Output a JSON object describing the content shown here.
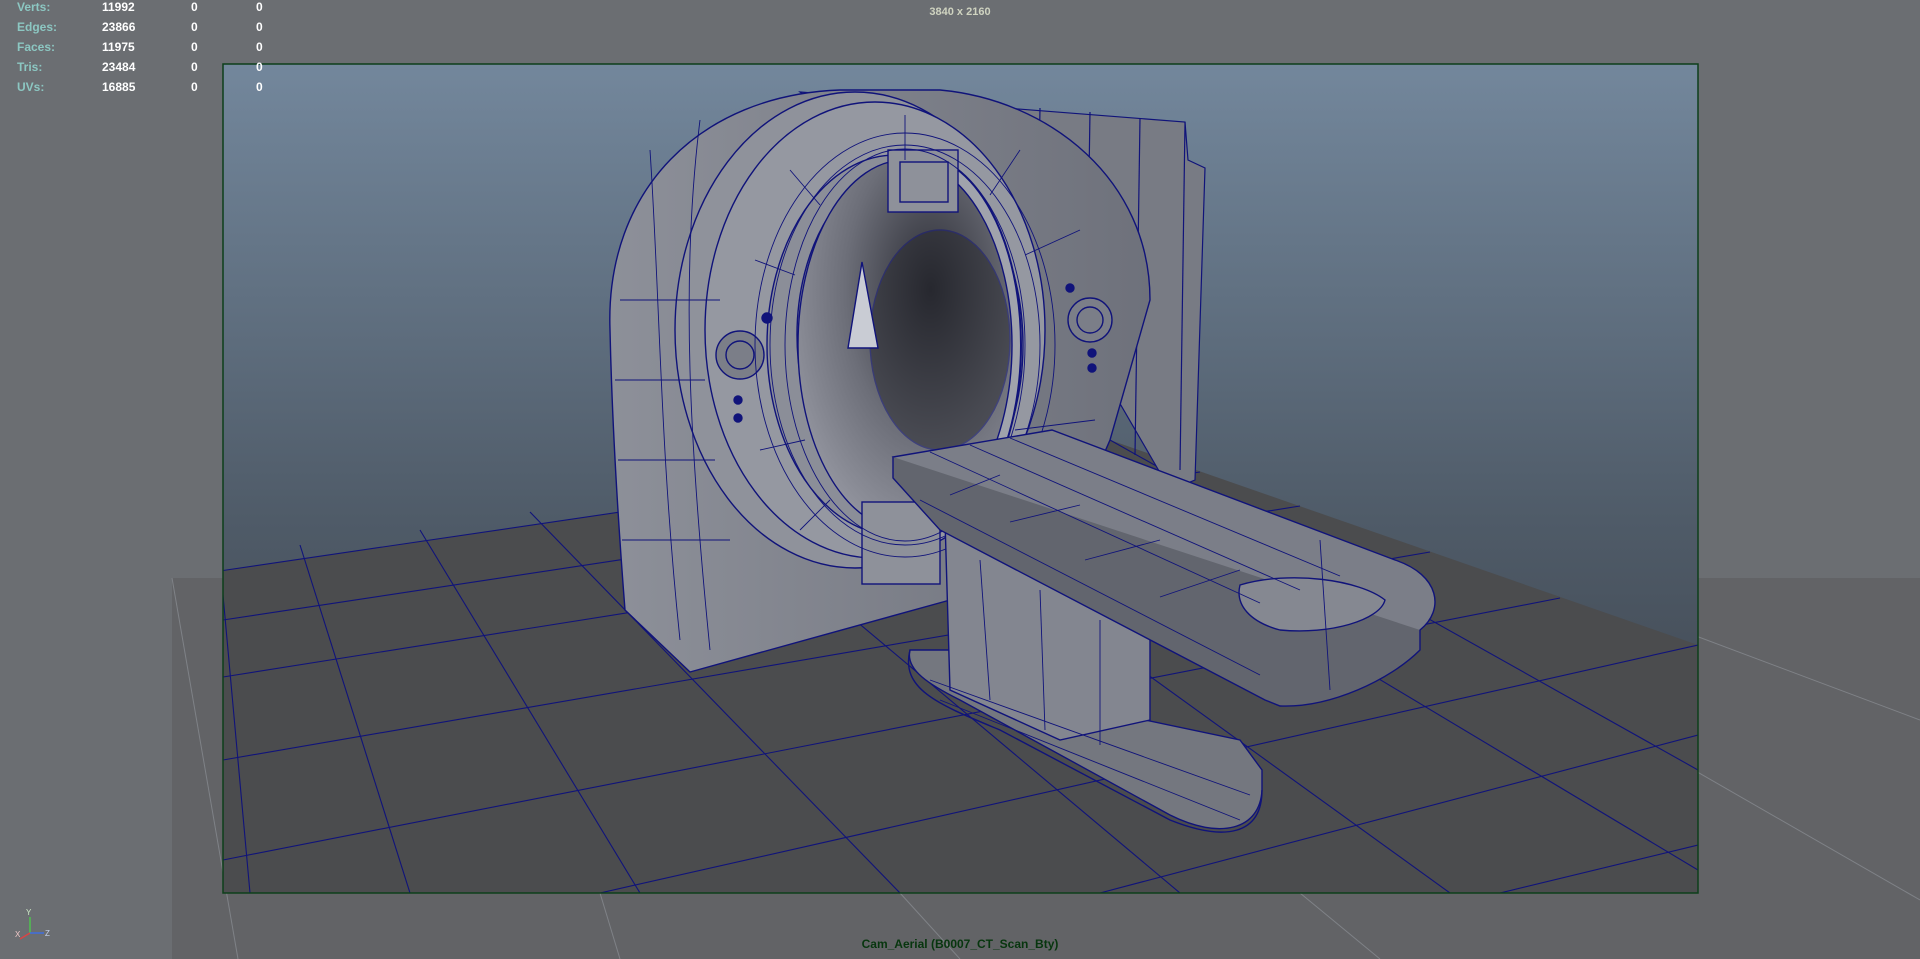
{
  "hud": {
    "rows": [
      {
        "label": "Verts:",
        "total": "11992",
        "selected": "0",
        "uv": "0"
      },
      {
        "label": "Edges:",
        "total": "23866",
        "selected": "0",
        "uv": "0"
      },
      {
        "label": "Faces:",
        "total": "11975",
        "selected": "0",
        "uv": "0"
      },
      {
        "label": "Tris:",
        "total": "23484",
        "selected": "0",
        "uv": "0"
      },
      {
        "label": "UVs:",
        "total": "16885",
        "selected": "0",
        "uv": "0"
      }
    ]
  },
  "resolution": "3840 x 2160",
  "camera": "Cam_Aerial (B0007_CT_Scan_Bty)",
  "axis": {
    "y": "Y",
    "x": "X",
    "z": "Z"
  },
  "colors": {
    "wireframe": "#10137a",
    "gate_border": "#0d3f1a",
    "floor": "#4b4c4e",
    "mesh_fill": "#7b7d85"
  },
  "icons": {
    "axis_gizmo": "axis-gizmo-icon"
  }
}
